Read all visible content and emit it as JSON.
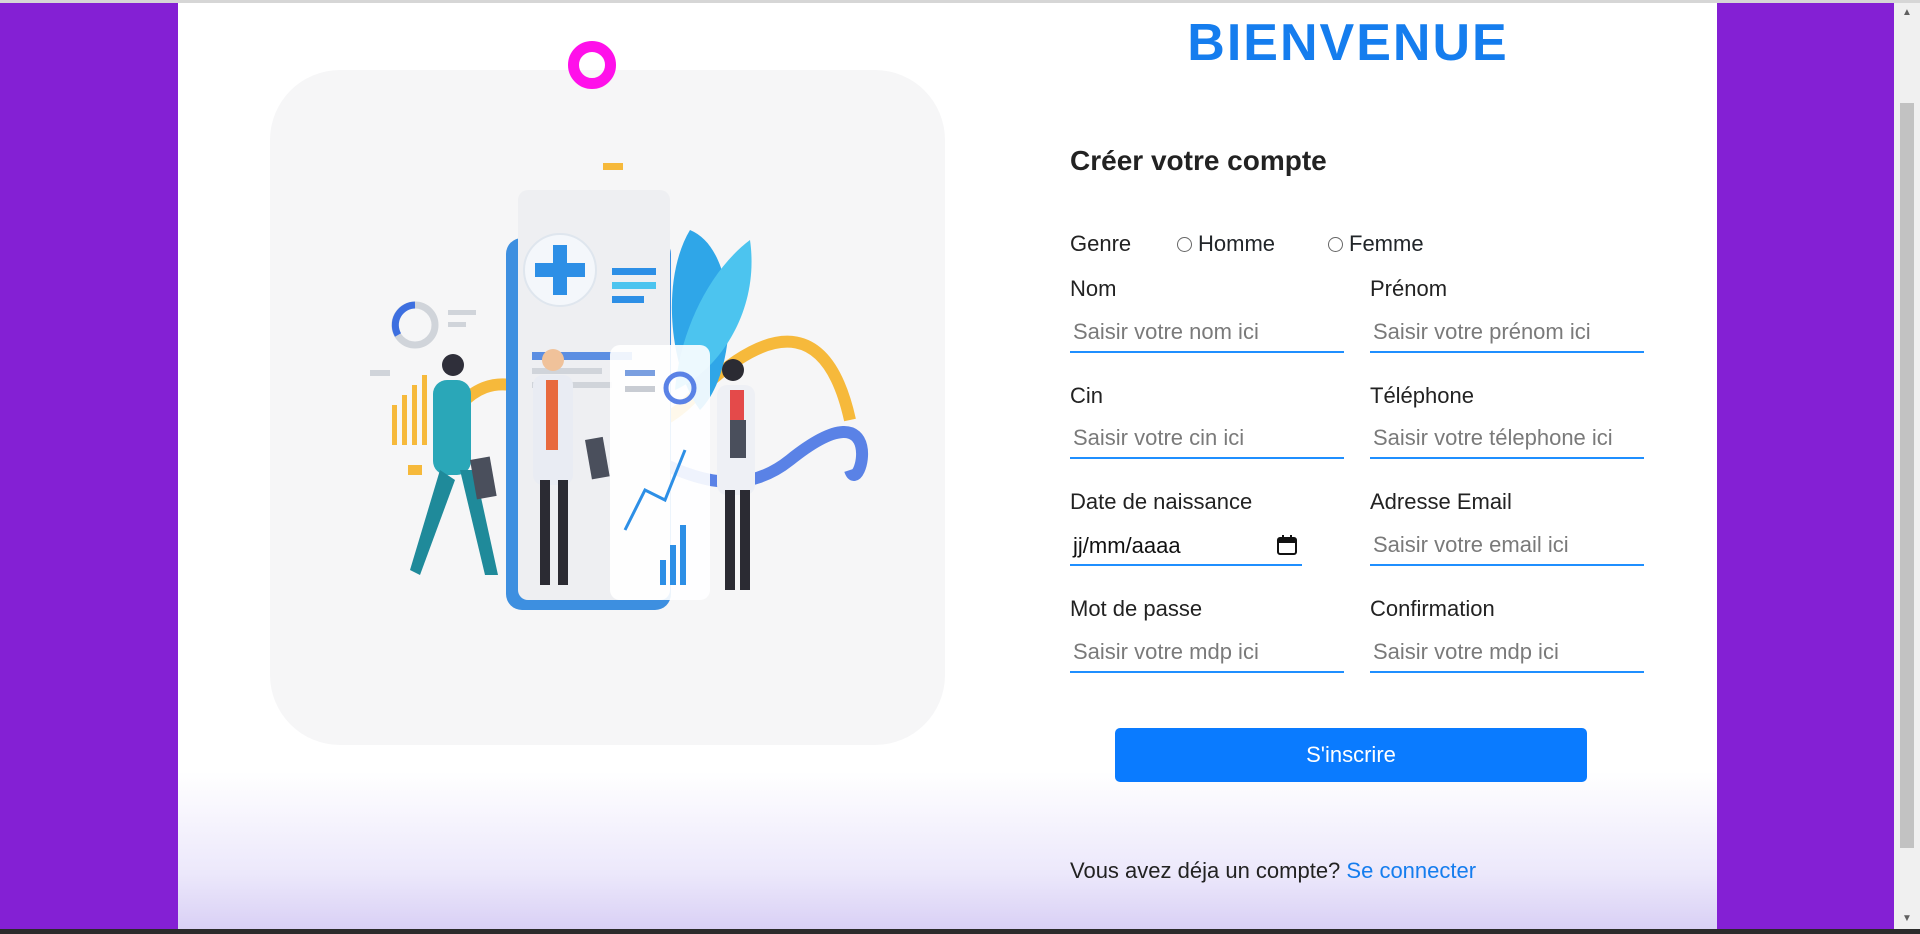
{
  "header": {
    "title": "BIENVENUE"
  },
  "form": {
    "subtitle": "Créer votre compte",
    "genre_label": "Genre",
    "genre_options": [
      "Homme",
      "Femme"
    ],
    "fields": {
      "nom": {
        "label": "Nom",
        "placeholder": "Saisir votre nom ici"
      },
      "prenom": {
        "label": "Prénom",
        "placeholder": "Saisir votre prénom ici"
      },
      "cin": {
        "label": "Cin",
        "placeholder": "Saisir votre cin ici"
      },
      "telephone": {
        "label": "Téléphone",
        "placeholder": "Saisir votre télephone ici"
      },
      "date_naissance": {
        "label": "Date de naissance",
        "value": "jj/mm/aaaa"
      },
      "email": {
        "label": "Adresse Email",
        "placeholder": "Saisir votre email ici"
      },
      "mot_de_passe": {
        "label": "Mot de passe",
        "placeholder": "Saisir votre mdp ici"
      },
      "confirmation": {
        "label": "Confirmation",
        "placeholder": "Saisir votre mdp ici"
      }
    },
    "submit_label": "S'inscrire"
  },
  "footer": {
    "text": "Vous avez déja un compte?",
    "link_label": "Se connecter"
  },
  "colors": {
    "background": "#8420d4",
    "accent": "#0a7bff",
    "title": "#157dee",
    "ring": "#ff10ea"
  },
  "icons": [
    "calendar-icon",
    "medical-team-illustration"
  ]
}
